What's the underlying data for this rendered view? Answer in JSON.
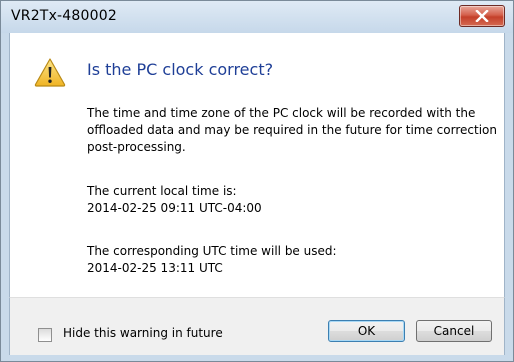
{
  "window": {
    "title": "VR2Tx-480002"
  },
  "dialog": {
    "heading": "Is the PC clock correct?",
    "paragraph1": "The time and time zone of the PC clock will be recorded with the offloaded data and may be required in the future for time correction post-processing.",
    "local_label": "The current local time is:",
    "local_time": "2014-02-25 09:11 UTC-04:00",
    "utc_label": "The corresponding UTC time will be used:",
    "utc_time": "2014-02-25 13:11 UTC"
  },
  "footer": {
    "checkbox_label": "Hide this warning in future",
    "checkbox_checked": false,
    "ok_label": "OK",
    "cancel_label": "Cancel"
  },
  "icons": {
    "warning": "warning-icon",
    "close": "close-icon"
  },
  "colors": {
    "heading": "#1f3f97",
    "close_button": "#c4402a",
    "warning_fill": "#f3c43f"
  }
}
